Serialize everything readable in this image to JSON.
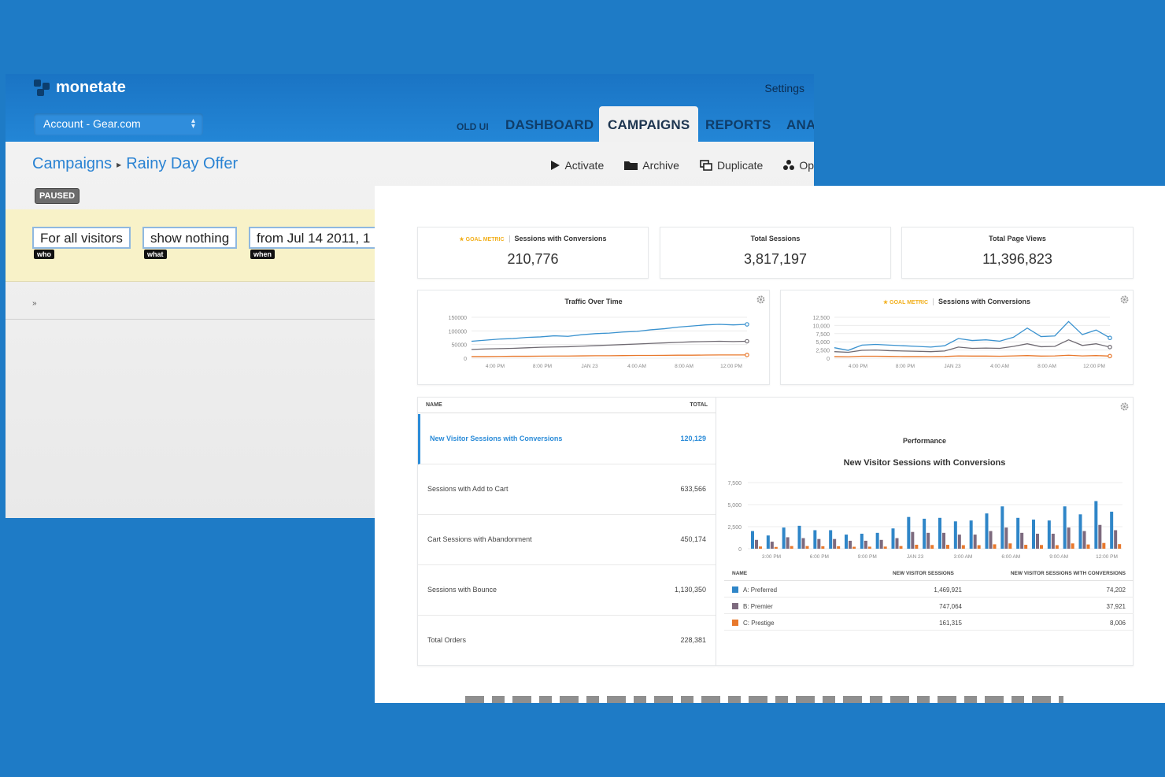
{
  "old_ui": {
    "brand": "monetate",
    "settings": "Settings",
    "account": "Account - Gear.com",
    "nav": {
      "old_ui": "OLD UI",
      "tabs": [
        "DASHBOARD",
        "CAMPAIGNS",
        "REPORTS",
        "ANA"
      ],
      "active_tab": "CAMPAIGNS"
    },
    "breadcrumb": {
      "root": "Campaigns",
      "current": "Rainy Day Offer"
    },
    "status_badge": "PAUSED",
    "actions": [
      "Activate",
      "Archive",
      "Duplicate",
      "Op"
    ],
    "rule_pills": [
      {
        "text": "For all visitors",
        "tag": "who"
      },
      {
        "text": "show nothing",
        "tag": "what"
      },
      {
        "text": "from Jul 14 2011, 1",
        "tag": "when"
      }
    ],
    "strip_mark": "»"
  },
  "new_ui": {
    "goal_label": "GOAL METRIC",
    "metrics": [
      {
        "title": "Sessions with Conversions",
        "value": "210,776",
        "goal": true
      },
      {
        "title": "Total Sessions",
        "value": "3,817,197",
        "goal": false
      },
      {
        "title": "Total Page Views",
        "value": "11,396,823",
        "goal": false
      }
    ],
    "traffic_title": "Traffic Over Time",
    "conversions_title": "Sessions with Conversions",
    "table": {
      "headers": [
        "NAME",
        "TOTAL"
      ],
      "rows": [
        {
          "name": "New Visitor Sessions with Conversions",
          "total": "120,129",
          "active": true
        },
        {
          "name": "Sessions with Add to Cart",
          "total": "633,566",
          "active": false
        },
        {
          "name": "Cart Sessions with Abandonment",
          "total": "450,174",
          "active": false
        },
        {
          "name": "Sessions with Bounce",
          "total": "1,130,350",
          "active": false
        },
        {
          "name": "Total Orders",
          "total": "228,381",
          "active": false
        }
      ]
    },
    "performance": {
      "subtitle": "Performance",
      "title": "New Visitor Sessions with Conversions",
      "legend_headers": [
        "NAME",
        "NEW VISITOR SESSIONS",
        "NEW VISITOR SESSIONS WITH CONVERSIONS"
      ],
      "legend_rows": [
        {
          "name": "A: Preferred",
          "sessions": "1,469,921",
          "conversions": "74,202",
          "color": "#2f86c8"
        },
        {
          "name": "B: Premier",
          "sessions": "747,064",
          "conversions": "37,921",
          "color": "#7d6a7e"
        },
        {
          "name": "C: Prestige",
          "sessions": "161,315",
          "conversions": "8,006",
          "color": "#e8782c"
        }
      ]
    }
  },
  "chart_data": [
    {
      "type": "line",
      "title": "Traffic Over Time",
      "x": [
        "4:00 PM",
        "8:00 PM",
        "JAN 23",
        "4:00 AM",
        "8:00 AM",
        "12:00 PM"
      ],
      "yticks": [
        "150000",
        "100000",
        "50000",
        "0"
      ],
      "ylim": [
        0,
        150000
      ],
      "series": [
        {
          "color": "#3a92cf",
          "values": [
            62000,
            66000,
            70000,
            72000,
            76000,
            78000,
            82000,
            80000,
            86000,
            90000,
            92000,
            96000,
            98000,
            104000,
            108000,
            114000,
            118000,
            122000,
            124000,
            122000,
            124000
          ]
        },
        {
          "color": "#6f6a72",
          "values": [
            32000,
            34000,
            35000,
            36000,
            38000,
            40000,
            41000,
            42000,
            44000,
            46000,
            48000,
            50000,
            52000,
            54000,
            56000,
            58000,
            60000,
            61000,
            62000,
            61000,
            62000
          ]
        },
        {
          "color": "#e8782c",
          "values": [
            6000,
            6000,
            6500,
            7000,
            7000,
            7500,
            8000,
            8000,
            8500,
            9000,
            9000,
            9500,
            10000,
            10000,
            10500,
            11000,
            11000,
            11500,
            12000,
            12000,
            12000
          ]
        }
      ]
    },
    {
      "type": "line",
      "title": "Sessions with Conversions",
      "x": [
        "4:00 PM",
        "8:00 PM",
        "JAN 23",
        "4:00 AM",
        "8:00 AM",
        "12:00 PM"
      ],
      "yticks": [
        "12,500",
        "10,000",
        "7,500",
        "5,000",
        "2,500",
        "0"
      ],
      "ylim": [
        0,
        12500
      ],
      "series": [
        {
          "color": "#3a92cf",
          "values": [
            3200,
            2400,
            4000,
            4200,
            4000,
            3800,
            3600,
            3400,
            3800,
            6000,
            5400,
            5600,
            5200,
            6400,
            9200,
            6600,
            6800,
            11200,
            7200,
            8600,
            6200
          ]
        },
        {
          "color": "#6f6a72",
          "values": [
            2000,
            1800,
            2400,
            2500,
            2300,
            2200,
            2100,
            2000,
            2200,
            3400,
            3000,
            3100,
            3000,
            3600,
            4400,
            3500,
            3600,
            5600,
            3900,
            4400,
            3400
          ]
        },
        {
          "color": "#e8782c",
          "values": [
            500,
            450,
            600,
            600,
            550,
            500,
            500,
            480,
            520,
            700,
            650,
            650,
            600,
            700,
            800,
            650,
            700,
            900,
            700,
            800,
            650
          ]
        }
      ]
    },
    {
      "type": "bar",
      "title": "New Visitor Sessions with Conversions",
      "x": [
        "3:00 PM",
        "6:00 PM",
        "9:00 PM",
        "JAN 23",
        "3:00 AM",
        "6:00 AM",
        "9:00 AM",
        "12:00 PM"
      ],
      "yticks": [
        "7,500",
        "5,000",
        "2,500",
        "0"
      ],
      "ylim": [
        0,
        7500
      ],
      "series": [
        {
          "name": "A: Preferred",
          "color": "#2f86c8",
          "values": [
            2000,
            1500,
            2400,
            2600,
            2100,
            2100,
            1600,
            1700,
            1800,
            2300,
            3600,
            3400,
            3500,
            3100,
            3200,
            4000,
            4800,
            3500,
            3300,
            3200,
            4800,
            3900,
            5400,
            4200
          ]
        },
        {
          "name": "B: Premier",
          "color": "#7d6a7e",
          "values": [
            1000,
            800,
            1300,
            1200,
            1100,
            1100,
            900,
            900,
            1000,
            1200,
            1900,
            1800,
            1800,
            1600,
            1600,
            2000,
            2400,
            1800,
            1700,
            1700,
            2400,
            2000,
            2700,
            2100
          ]
        },
        {
          "name": "C: Prestige",
          "color": "#e8782c",
          "values": [
            250,
            200,
            300,
            300,
            280,
            280,
            220,
            230,
            240,
            300,
            450,
            420,
            440,
            400,
            400,
            500,
            600,
            440,
            420,
            400,
            600,
            480,
            650,
            520
          ]
        }
      ]
    }
  ]
}
